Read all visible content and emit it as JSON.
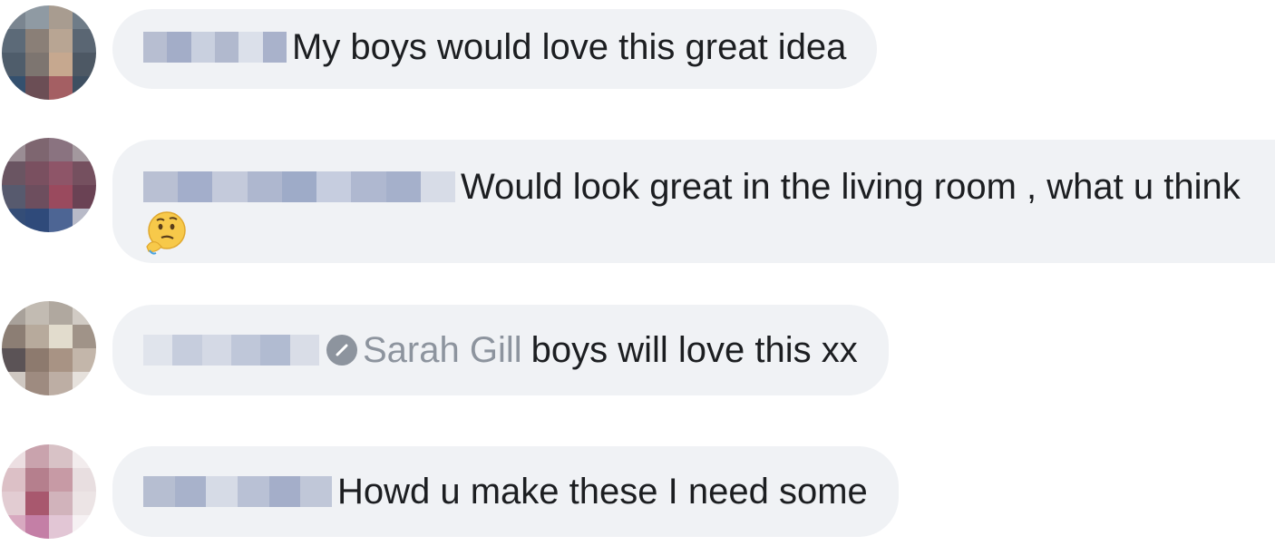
{
  "comments": [
    {
      "text": "My boys would love this great idea"
    },
    {
      "text": "Would look great in the living room , what u think",
      "emoji_name": "thinking-face-emoji"
    },
    {
      "mention": "Sarah Gill",
      "text": "boys will love this xx"
    },
    {
      "text": "Howd u make these I need some"
    }
  ],
  "colors": {
    "bubble_bg": "#f0f2f5",
    "text": "#1c1e21",
    "mention": "#8d949e"
  }
}
